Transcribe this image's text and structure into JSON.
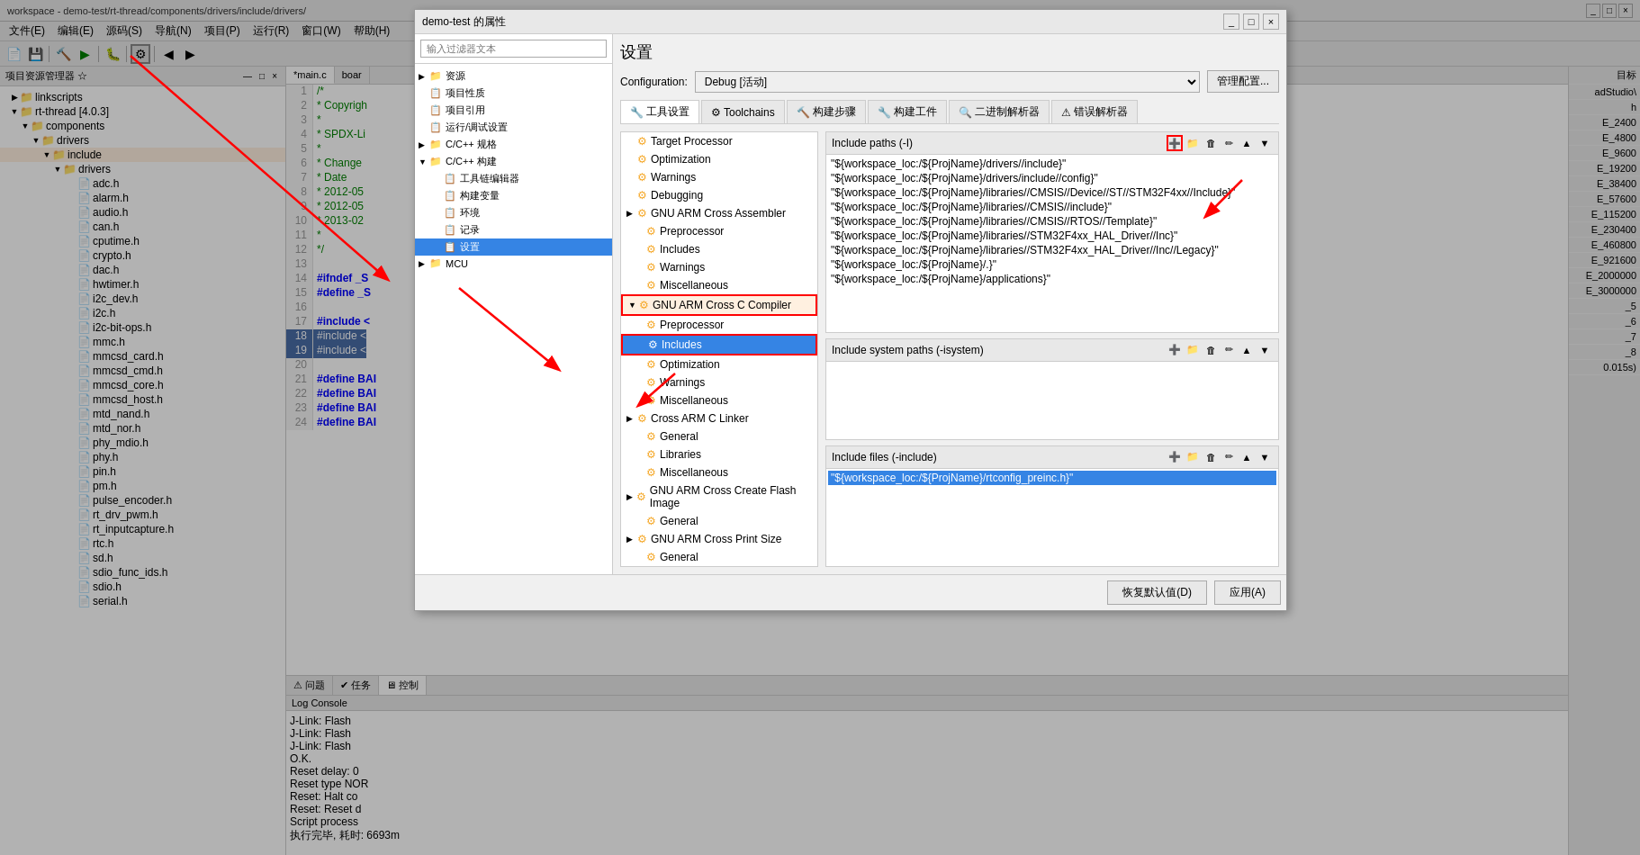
{
  "window": {
    "title": "workspace - demo-test/rt-thread/components/drivers/include/drivers/",
    "dialog_title": "demo-test 的属性"
  },
  "menubar": {
    "items": [
      "文件(E)",
      "编辑(E)",
      "源码(S)",
      "导航(N)",
      "项目(P)",
      "运行(R)",
      "窗口(W)",
      "帮助(H)"
    ]
  },
  "left_panel": {
    "title": "项目资源管理器 ☆",
    "tree": [
      {
        "label": "linkscripts",
        "indent": 1,
        "type": "folder",
        "expanded": false
      },
      {
        "label": "rt-thread [4.0.3]",
        "indent": 1,
        "type": "folder",
        "expanded": true
      },
      {
        "label": "components",
        "indent": 2,
        "type": "folder",
        "expanded": true
      },
      {
        "label": "drivers",
        "indent": 3,
        "type": "folder",
        "expanded": true
      },
      {
        "label": "include",
        "indent": 4,
        "type": "folder",
        "expanded": true,
        "highlighted": true
      },
      {
        "label": "drivers",
        "indent": 5,
        "type": "folder",
        "expanded": true
      },
      {
        "label": "adc.h",
        "indent": 6,
        "type": "file"
      },
      {
        "label": "alarm.h",
        "indent": 6,
        "type": "file"
      },
      {
        "label": "audio.h",
        "indent": 6,
        "type": "file"
      },
      {
        "label": "can.h",
        "indent": 6,
        "type": "file"
      },
      {
        "label": "cputime.h",
        "indent": 6,
        "type": "file"
      },
      {
        "label": "crypto.h",
        "indent": 6,
        "type": "file"
      },
      {
        "label": "dac.h",
        "indent": 6,
        "type": "file"
      },
      {
        "label": "hwtimer.h",
        "indent": 6,
        "type": "file"
      },
      {
        "label": "i2c_dev.h",
        "indent": 6,
        "type": "file"
      },
      {
        "label": "i2c.h",
        "indent": 6,
        "type": "file"
      },
      {
        "label": "i2c-bit-ops.h",
        "indent": 6,
        "type": "file"
      },
      {
        "label": "mmc.h",
        "indent": 6,
        "type": "file"
      },
      {
        "label": "mmcsd_card.h",
        "indent": 6,
        "type": "file"
      },
      {
        "label": "mmcsd_cmd.h",
        "indent": 6,
        "type": "file"
      },
      {
        "label": "mmcsd_core.h",
        "indent": 6,
        "type": "file"
      },
      {
        "label": "mmcsd_host.h",
        "indent": 6,
        "type": "file"
      },
      {
        "label": "mtd_nand.h",
        "indent": 6,
        "type": "file"
      },
      {
        "label": "mtd_nor.h",
        "indent": 6,
        "type": "file"
      },
      {
        "label": "phy_mdio.h",
        "indent": 6,
        "type": "file"
      },
      {
        "label": "phy.h",
        "indent": 6,
        "type": "file"
      },
      {
        "label": "pin.h",
        "indent": 6,
        "type": "file"
      },
      {
        "label": "pm.h",
        "indent": 6,
        "type": "file"
      },
      {
        "label": "pulse_encoder.h",
        "indent": 6,
        "type": "file"
      },
      {
        "label": "rt_drv_pwm.h",
        "indent": 6,
        "type": "file"
      },
      {
        "label": "rt_inputcapture.h",
        "indent": 6,
        "type": "file"
      },
      {
        "label": "rtc.h",
        "indent": 6,
        "type": "file"
      },
      {
        "label": "sd.h",
        "indent": 6,
        "type": "file"
      },
      {
        "label": "sdio_func_ids.h",
        "indent": 6,
        "type": "file"
      },
      {
        "label": "sdio.h",
        "indent": 6,
        "type": "file"
      },
      {
        "label": "serial.h",
        "indent": 6,
        "type": "file"
      }
    ]
  },
  "editor": {
    "tabs": [
      "*main.c",
      "boar"
    ],
    "lines": [
      {
        "num": 1,
        "code": "/* ",
        "style": "comment"
      },
      {
        "num": 2,
        "code": " * Copyrigh",
        "style": "comment"
      },
      {
        "num": 3,
        "code": " *",
        "style": "comment"
      },
      {
        "num": 4,
        "code": " * SPDX-Li",
        "style": "comment"
      },
      {
        "num": 5,
        "code": " *",
        "style": "comment"
      },
      {
        "num": 6,
        "code": " * Change",
        "style": "comment"
      },
      {
        "num": 7,
        "code": " * Date",
        "style": "comment"
      },
      {
        "num": 8,
        "code": " * 2012-05",
        "style": "comment"
      },
      {
        "num": 9,
        "code": " * 2012-05",
        "style": "comment"
      },
      {
        "num": 10,
        "code": " * 2013-02",
        "style": "comment"
      },
      {
        "num": 11,
        "code": " *",
        "style": "comment"
      },
      {
        "num": 12,
        "code": " */",
        "style": "comment"
      },
      {
        "num": 13,
        "code": "",
        "style": "normal"
      },
      {
        "num": 14,
        "code": "#ifndef _S",
        "style": "preprocessor"
      },
      {
        "num": 15,
        "code": "#define _S",
        "style": "preprocessor"
      },
      {
        "num": 16,
        "code": "",
        "style": "normal"
      },
      {
        "num": 17,
        "code": "#include <",
        "style": "preprocessor"
      },
      {
        "num": 18,
        "code": "#include <",
        "style": "highlight"
      },
      {
        "num": 19,
        "code": "#include <",
        "style": "highlight"
      },
      {
        "num": 20,
        "code": "",
        "style": "normal"
      },
      {
        "num": 21,
        "code": "#define BAI",
        "style": "preprocessor"
      },
      {
        "num": 22,
        "code": "#define BAI",
        "style": "preprocessor"
      },
      {
        "num": 23,
        "code": "#define BAI",
        "style": "preprocessor"
      },
      {
        "num": 24,
        "code": "#define BAI",
        "style": "preprocessor"
      }
    ]
  },
  "bottom_panel": {
    "tabs": [
      "问题",
      "任务",
      "控制"
    ],
    "log_title": "Log Console",
    "log_lines": [
      "J-Link: Flash",
      "J-Link: Flash",
      "J-Link: Flash",
      "O.K.",
      "",
      "Reset delay: 0",
      "Reset type NOR",
      "Reset: Halt co",
      "Reset: Reset d",
      "Script process",
      "执行完毕, 耗时: 6693m"
    ]
  },
  "dialog": {
    "title": "demo-test 的属性",
    "search_placeholder": "输入过滤器文本",
    "nav_items": [
      {
        "label": "资源",
        "indent": 1,
        "arrow": "▶"
      },
      {
        "label": "项目性质",
        "indent": 1,
        "arrow": ""
      },
      {
        "label": "项目引用",
        "indent": 1,
        "arrow": ""
      },
      {
        "label": "运行/调试设置",
        "indent": 1,
        "arrow": ""
      },
      {
        "label": "C/C++ 规格",
        "indent": 1,
        "arrow": "▶"
      },
      {
        "label": "C/C++ 构建",
        "indent": 1,
        "arrow": "▶",
        "expanded": true
      },
      {
        "label": "工具链编辑器",
        "indent": 2,
        "arrow": ""
      },
      {
        "label": "构建变量",
        "indent": 2,
        "arrow": ""
      },
      {
        "label": "环境",
        "indent": 2,
        "arrow": ""
      },
      {
        "label": "记录",
        "indent": 2,
        "arrow": ""
      },
      {
        "label": "设置",
        "indent": 2,
        "arrow": "",
        "selected": true
      },
      {
        "label": "MCU",
        "indent": 1,
        "arrow": "▶"
      }
    ],
    "heading": "设置",
    "config_label": "Configuration:",
    "config_value": "Debug [活动]",
    "manage_btn": "管理配置...",
    "tabs": [
      {
        "label": "🔧 工具设置",
        "active": true
      },
      {
        "label": "⚙ Toolchains"
      },
      {
        "label": "🔨 构建步骤"
      },
      {
        "label": "🔧 构建工件"
      },
      {
        "label": "🔍 二进制解析器"
      },
      {
        "label": "⚠ 错误解析器"
      }
    ],
    "settings_tree": [
      {
        "label": "Target Processor",
        "indent": 0,
        "arrow": ""
      },
      {
        "label": "Optimization",
        "indent": 0,
        "arrow": ""
      },
      {
        "label": "Warnings",
        "indent": 0,
        "arrow": ""
      },
      {
        "label": "Debugging",
        "indent": 0,
        "arrow": ""
      },
      {
        "label": "GNU ARM Cross Assembler",
        "indent": 0,
        "arrow": "▶",
        "expanded": true
      },
      {
        "label": "Preprocessor",
        "indent": 1,
        "arrow": ""
      },
      {
        "label": "Includes",
        "indent": 1,
        "arrow": ""
      },
      {
        "label": "Warnings",
        "indent": 1,
        "arrow": ""
      },
      {
        "label": "Miscellaneous",
        "indent": 1,
        "arrow": ""
      },
      {
        "label": "GNU ARM Cross C Compiler",
        "indent": 0,
        "arrow": "▼",
        "expanded": true,
        "highlighted": true
      },
      {
        "label": "Preprocessor",
        "indent": 1,
        "arrow": ""
      },
      {
        "label": "Includes",
        "indent": 1,
        "arrow": "",
        "selected": true
      },
      {
        "label": "Optimization",
        "indent": 1,
        "arrow": ""
      },
      {
        "label": "Warnings",
        "indent": 1,
        "arrow": ""
      },
      {
        "label": "Miscellaneous",
        "indent": 1,
        "arrow": ""
      },
      {
        "label": "Cross ARM C Linker",
        "indent": 0,
        "arrow": "▶",
        "expanded": true
      },
      {
        "label": "General",
        "indent": 1,
        "arrow": ""
      },
      {
        "label": "Libraries",
        "indent": 1,
        "arrow": ""
      },
      {
        "label": "Miscellaneous",
        "indent": 1,
        "arrow": ""
      },
      {
        "label": "GNU ARM Cross Create Flash Image",
        "indent": 0,
        "arrow": "▶",
        "expanded": true
      },
      {
        "label": "General",
        "indent": 1,
        "arrow": ""
      },
      {
        "label": "GNU ARM Cross Print Size",
        "indent": 0,
        "arrow": "▶",
        "expanded": true
      },
      {
        "label": "General",
        "indent": 1,
        "arrow": ""
      }
    ],
    "include_paths": {
      "header": "Include paths (-I)",
      "entries": [
        "\"${workspace_loc:/${ProjName}/drivers//include}\"",
        "\"${workspace_loc:/${ProjName}/drivers/include//config}\"",
        "\"${workspace_loc:/${ProjName}/libraries//CMSIS//Device//ST//STM32F4xx//Include}\"",
        "\"${workspace_loc:/${ProjName}/libraries//CMSIS//include}\"",
        "\"${workspace_loc:/${ProjName}/libraries//CMSIS//RTOS//Template}\"",
        "\"${workspace_loc:/${ProjName}/libraries//STM32F4xx_HAL_Driver//Inc}\"",
        "\"${workspace_loc:/${ProjName}/libraries//STM32F4xx_HAL_Driver//Inc//Legacy}\"",
        "\"${workspace_loc:/${ProjName}/.}\"",
        "\"${workspace_loc:/${ProjName}/applications}\""
      ]
    },
    "include_system_paths": {
      "header": "Include system paths (-isystem)"
    },
    "include_files": {
      "header": "Include files (-include)",
      "entries": [
        "\"${workspace_loc:/${ProjName}/rtconfig_preinc.h}\""
      ]
    },
    "footer": {
      "restore_btn": "恢复默认值(D)",
      "apply_btn": "应用(A)"
    }
  },
  "right_sidebar": {
    "items": [
      "目标",
      "adStudio\\",
      "h",
      "E_2400",
      "E_4800",
      "E_9600",
      "E_19200",
      "E_38400",
      "E_57600",
      "E_115200",
      "E_230400",
      "E_460800",
      "E_921600",
      "E_2000000",
      "E_3000000",
      "_5",
      "_6",
      "_7",
      "_8",
      "⅐",
      "0.015s)"
    ]
  }
}
